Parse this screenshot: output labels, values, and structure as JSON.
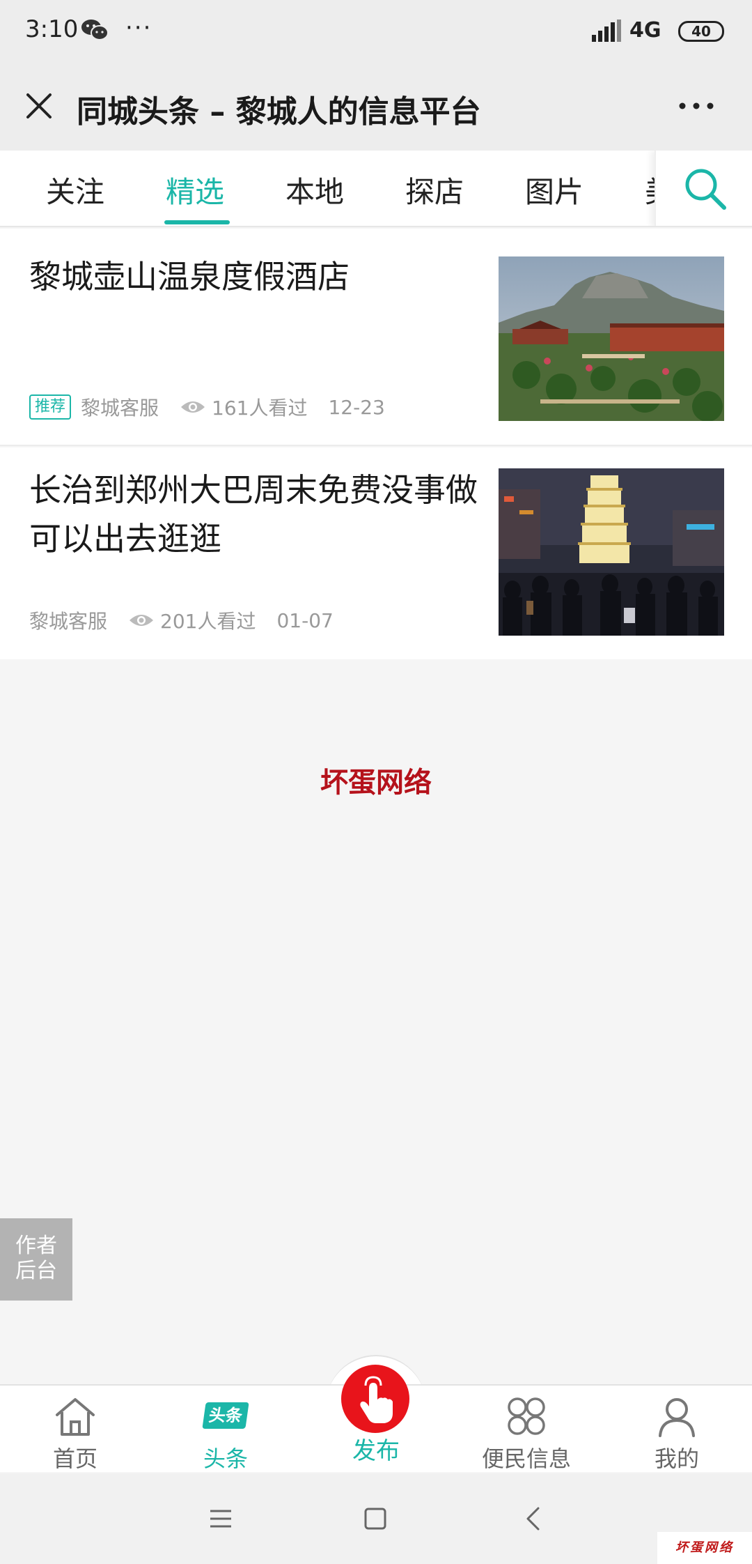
{
  "status_bar": {
    "time": "3:10",
    "more": "···",
    "network": "4G",
    "battery": "40"
  },
  "titlebar": {
    "title": "同城头条 – 黎城人的信息平台"
  },
  "tabs": [
    {
      "label": "关注"
    },
    {
      "label": "精选"
    },
    {
      "label": "本地"
    },
    {
      "label": "探店"
    },
    {
      "label": "图片"
    },
    {
      "label": "美"
    }
  ],
  "active_tab": "精选",
  "articles": [
    {
      "title": "黎城壶山温泉度假酒店",
      "badge": "推荐",
      "source": "黎城客服",
      "views": "161人看过",
      "date": "12-23"
    },
    {
      "title": "长治到郑州大巴周末免费没事做可以出去逛逛",
      "source": "黎城客服",
      "views": "201人看过",
      "date": "01-07"
    }
  ],
  "watermark": "坏蛋网络",
  "author_button": {
    "line1": "作者",
    "line2": "后台"
  },
  "bottom_nav": [
    {
      "label": "首页"
    },
    {
      "label": "头条",
      "icon_text": "头条"
    },
    {
      "label": "发布"
    },
    {
      "label": "便民信息"
    },
    {
      "label": "我的"
    }
  ],
  "corner_watermark": "坏蛋网络",
  "colors": {
    "accent": "#1bb6a8",
    "publish": "#e8141b",
    "watermark": "#b5121b"
  }
}
